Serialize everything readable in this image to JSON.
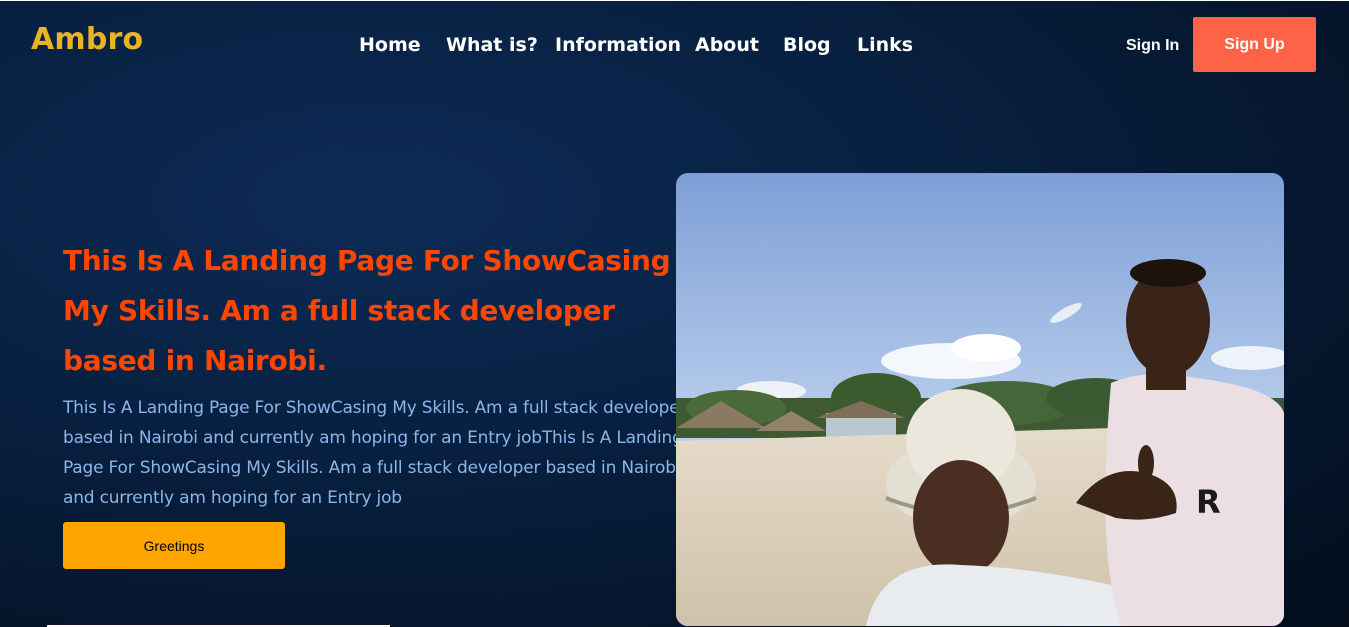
{
  "header": {
    "logo": "Ambro",
    "nav": [
      {
        "label": "Home"
      },
      {
        "label": "What is?"
      },
      {
        "label": "Information"
      },
      {
        "label": "About"
      },
      {
        "label": "Blog"
      },
      {
        "label": "Links"
      }
    ],
    "sign_in": "Sign In",
    "sign_up": "Sign Up"
  },
  "hero": {
    "headline": "This Is A Landing Page For ShowCasing My Skills. Am a full stack developer based in Nairobi.",
    "description": "This Is A Landing Page For ShowCasing My Skills. Am a full stack developer based in Nairobi and currently am hoping for an Entry jobThis Is A Landing Page For ShowCasing My Skills. Am a full stack developer based in Nairobi and currently am hoping for an Entry job",
    "button": "Greetings"
  },
  "colors": {
    "logo": "#e8b422",
    "accent_signup": "#ff6347",
    "headline": "#ff4500",
    "description": "#8ab6e8",
    "button": "#ffa500"
  },
  "photo": {
    "subject": "beach-selfie-photo"
  }
}
